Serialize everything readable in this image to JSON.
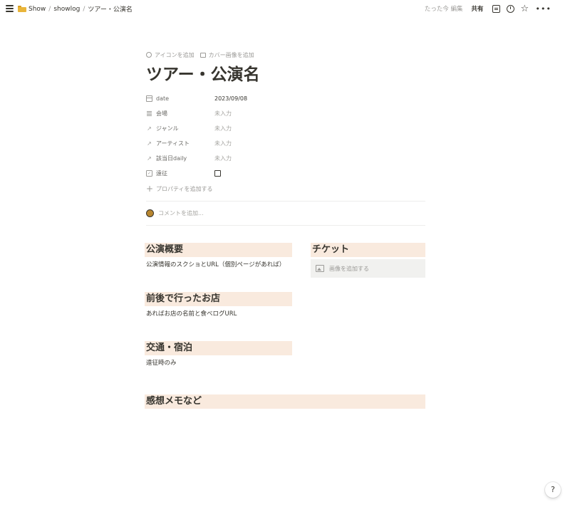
{
  "topbar": {
    "breadcrumb": [
      "Show",
      "showlog",
      "ツアー・公演名"
    ],
    "separator": "/",
    "edited": "たった今 編集",
    "share": "共有"
  },
  "page": {
    "add_icon": "アイコンを追加",
    "add_cover": "カバー画像を追加",
    "title": "ツアー・公演名"
  },
  "properties": [
    {
      "icon": "calendar-icon",
      "name": "date",
      "value": "2023/09/08"
    },
    {
      "icon": "text-icon",
      "name": "会場",
      "value": "未入力"
    },
    {
      "icon": "relation-arrow-icon",
      "name": "ジャンル",
      "value": "未入力"
    },
    {
      "icon": "relation-arrow-icon",
      "name": "アーティスト",
      "value": "未入力"
    },
    {
      "icon": "relation-arrow-icon",
      "name": "該当日daily",
      "value": "未入力"
    },
    {
      "icon": "checkbox-icon",
      "name": "遠征",
      "value": ""
    }
  ],
  "add_property": "プロパティを追加する",
  "comment_placeholder": "コメントを追加...",
  "sections": {
    "overview": {
      "heading": "公演概要",
      "text": "公演情報のスクショとURL（個別ページがあれば）"
    },
    "ticket": {
      "heading": "チケット",
      "button": "画像を追加する"
    },
    "shops": {
      "heading": "前後で行ったお店",
      "text": "あればお店の名前と食べログURL"
    },
    "travel": {
      "heading": "交通・宿泊",
      "text": "遠征時のみ"
    },
    "memo": {
      "heading": "感想メモなど"
    }
  },
  "help": "?",
  "colors": {
    "heading_bg": "#f9eade",
    "text": "#37352f",
    "muted": "#9b9a97"
  }
}
